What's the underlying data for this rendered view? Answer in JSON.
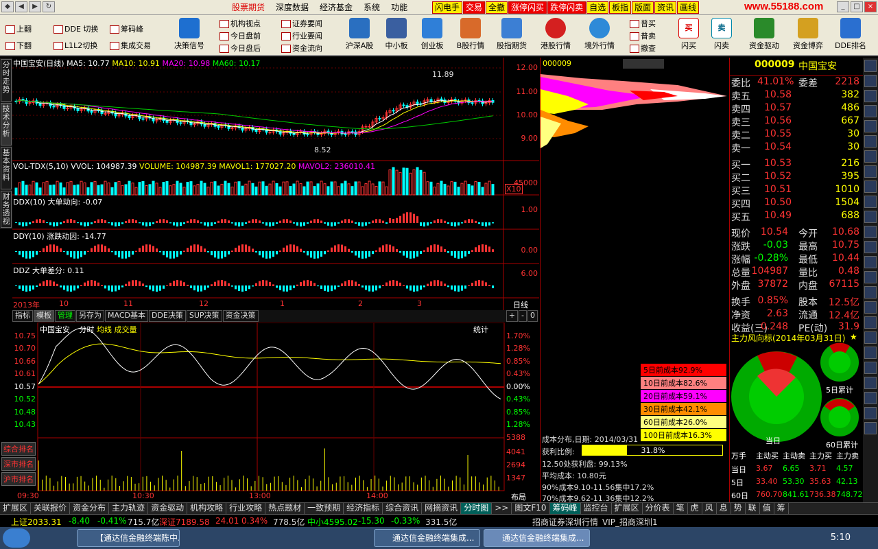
{
  "menubar": {
    "items": [
      "股票期货",
      "深度数据",
      "经济基金",
      "系统",
      "功能"
    ],
    "flash": [
      "闪电手",
      "交易",
      "全撤",
      "涨停闪买",
      "跌停闪卖",
      "自选",
      "板指",
      "版面",
      "资讯",
      "画线"
    ],
    "logo": "www.55188.com"
  },
  "toolbar": {
    "small": [
      "上翻",
      "下翻",
      "DDE 切换",
      "L1L2切换",
      "筹码峰",
      "集成交易",
      "机构视点",
      "今日盘前",
      "今日盘后",
      "证券要闻",
      "行业要闻",
      "资金流向",
      "普买",
      "普卖",
      "撤查"
    ],
    "big": [
      "决策信号",
      "沪深A股",
      "中小板",
      "创业板",
      "B股行情",
      "股指期货",
      "港股行情",
      "境外行情",
      "闪买",
      "闪卖",
      "资金驱动",
      "资金博弈",
      "DDE排名"
    ]
  },
  "left_side": [
    "分时走势",
    "技术分析",
    "基本资料",
    "财务透视"
  ],
  "main_chart": {
    "title": "中国宝安(日线)",
    "ma5": "MA5: 10.77",
    "ma10": "MA10: 10.91",
    "ma20": "MA20: 10.98",
    "ma60": "MA60: 10.17",
    "price_axis": [
      "12.00",
      "11.00",
      "10.00",
      "9.00"
    ],
    "high_mark": "11.89",
    "low_mark": "8.52"
  },
  "vol": {
    "label": "VOL-TDX(5,10)",
    "vvol": "VVOL: 104987.39",
    "volume": "VOLUME: 104987.39",
    "mavol1": "MAVOL1: 177027.20",
    "mavol2": "MAVOL2: 236010.41",
    "axis": "45000",
    "mult": "X10"
  },
  "ddx": {
    "label": "DDX(10) 大单动向: -0.07",
    "axis": "1.00"
  },
  "ddy": {
    "label": "DDY(10) 涨跌动因: -14.77",
    "axis": "0.00"
  },
  "ddz": {
    "label": "DDZ 大单差分: 0.11",
    "axis": "6.00"
  },
  "date_axis": [
    "2013年",
    "10",
    "11",
    "12",
    "1",
    "2",
    "3"
  ],
  "date_unit": "日线",
  "sub_tabs": [
    "指标",
    "模板",
    "管理",
    "另存为",
    "MACD基本",
    "DDE决策",
    "SUP决策",
    "资金决策"
  ],
  "intraday": {
    "name": "中国宝安",
    "mode": "分时",
    "avg": "均线",
    "vol": "成交量",
    "stat": "统计",
    "left_axis": [
      "10.75",
      "10.70",
      "10.66",
      "10.61",
      "10.57",
      "10.52",
      "10.48",
      "10.43"
    ],
    "right_axis": [
      "1.70%",
      "1.28%",
      "0.85%",
      "0.43%",
      "0.00%",
      "0.43%",
      "0.85%",
      "1.28%"
    ],
    "vol_axis": [
      "5388",
      "4041",
      "2694",
      "1347"
    ],
    "time_axis": [
      "09:30",
      "10:30",
      "13:00",
      "14:00"
    ],
    "layout": "布局",
    "rank_buttons": [
      "综合排名",
      "深市排名",
      "沪市排名"
    ]
  },
  "chip": {
    "code": "000009",
    "legend": [
      "5日前成本92.9%",
      "10日前成本82.6%",
      "20日前成本59.1%",
      "30日前成本42.1%",
      "60日前成本26.0%",
      "100日前成本16.3%"
    ],
    "legend_colors": [
      "#ff0000",
      "#ff8080",
      "#ff00ff",
      "#ff8c00",
      "#ffff80",
      "#ffff00"
    ],
    "price_axis": [
      "12.00",
      "11.00",
      "10.00",
      "9.00"
    ],
    "date": "成本分布,日期: 2014/03/31",
    "profit_label": "获利比例:",
    "profit_value": "31.8%",
    "profit_fraction": 0.318,
    "lines": [
      "12.50处获利盘: 99.13%",
      "平均成本: 10.80元",
      "90%成本9.10-11.56集中17.2%",
      "70%成本9.62-11.36集中12.2%"
    ]
  },
  "quote": {
    "code": "000009",
    "name": "中国宝安",
    "wb": "41.01%",
    "wc": "2218",
    "asks": [
      [
        "卖五",
        "10.58",
        "382"
      ],
      [
        "卖四",
        "10.57",
        "486"
      ],
      [
        "卖三",
        "10.56",
        "667"
      ],
      [
        "卖二",
        "10.55",
        "30"
      ],
      [
        "卖一",
        "10.54",
        "30"
      ]
    ],
    "bids": [
      [
        "买一",
        "10.53",
        "216"
      ],
      [
        "买二",
        "10.52",
        "395"
      ],
      [
        "买三",
        "10.51",
        "1010"
      ],
      [
        "买四",
        "10.50",
        "1504"
      ],
      [
        "买五",
        "10.49",
        "688"
      ]
    ],
    "stats": [
      [
        "现价",
        "10.54",
        "今开",
        "10.68"
      ],
      [
        "涨跌",
        "-0.03",
        "最高",
        "10.75"
      ],
      [
        "涨幅",
        "-0.28%",
        "最低",
        "10.44"
      ],
      [
        "总量",
        "104987",
        "量比",
        "0.48"
      ],
      [
        "外盘",
        "37872",
        "内盘",
        "67115"
      ],
      [
        "换手",
        "0.85%",
        "股本",
        "12.5亿"
      ],
      [
        "净资",
        "2.63",
        "流通",
        "12.4亿"
      ],
      [
        "收益(三)",
        "0.248",
        "PE(动)",
        "31.9"
      ]
    ],
    "flow_title": "主力风向标(2014年03月31日)",
    "today": "当日",
    "five": "5日累计",
    "sixty": "60日累计",
    "table_header": [
      "万手",
      "主动买",
      "主动卖",
      "主力买",
      "主力卖"
    ],
    "table_rows": [
      [
        "当日",
        "3.67",
        "6.65",
        "3.71",
        "4.57"
      ],
      [
        "5日",
        "33.40",
        "53.30",
        "35.63",
        "42.13"
      ],
      [
        "60日",
        "760.70",
        "841.61",
        "736.38",
        "748.72"
      ]
    ]
  },
  "bottom_tabs": [
    "扩展区",
    "关联报价",
    "资金分布",
    "主力轨迹",
    "资金驱动",
    "机构攻略",
    "行业攻略",
    "热点题材",
    "一致预期",
    "经济指标",
    "综合资讯",
    "网摘资讯",
    "分时图",
    ">>",
    "图文F10",
    "筹码峰",
    "监控台",
    "扩展区",
    "分价表",
    "笔",
    "虎",
    "风",
    "息",
    "势",
    "联",
    "值",
    "筹"
  ],
  "status": {
    "sh": "上证2033.31",
    "sh_chg": "-8.40",
    "sh_pct": "-0.41%",
    "sh_amt": "715.7亿",
    "sz": "深证7189.58",
    "sz_chg": "24.01",
    "sz_pct": "0.34%",
    "sz_amt": "778.5亿",
    "zx": "中小4595.02",
    "zx_chg": "-15.30",
    "zx_pct": "-0.33%",
    "zx_amt": "331.5亿",
    "broker": "招商证券深圳行情",
    "vip": "VIP_招商深圳1"
  },
  "taskbar": {
    "items": [
      "【通达信金融终端陈中...",
      "通达信金融终端集成...",
      "通达信金融终端集成..."
    ],
    "time": "5:10"
  },
  "colors": {
    "up": "#ff3030",
    "down": "#00ffff",
    "accent": "#ffff00",
    "panel_border": "#aa0000"
  }
}
